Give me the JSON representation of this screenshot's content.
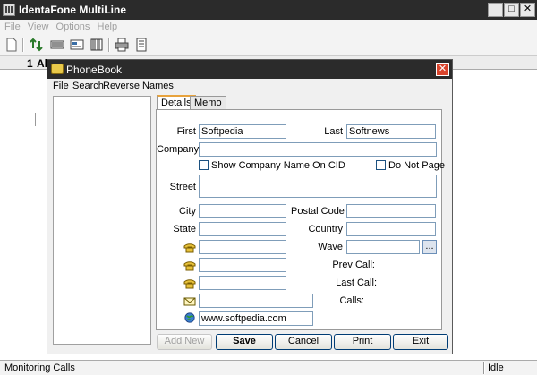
{
  "main": {
    "title": "IdentaFone MultiLine",
    "menu": [
      "File",
      "View",
      "Options",
      "Help"
    ],
    "grid": {
      "row_number": "1",
      "column_header": "Al"
    },
    "status": {
      "left": "Monitoring Calls",
      "right": "Idle"
    },
    "window_buttons": {
      "minimize": "_",
      "maximize": "□",
      "close": "✕"
    }
  },
  "dialog": {
    "title": "PhoneBook",
    "close": "✕",
    "menu": [
      "File",
      "Search",
      "Reverse Names"
    ],
    "tabs": [
      "Details",
      "Memo"
    ],
    "labels": {
      "first": "First",
      "last": "Last",
      "company": "Company",
      "street": "Street",
      "city": "City",
      "postal": "Postal Code",
      "state": "State",
      "country": "Country",
      "wave": "Wave",
      "prev_call": "Prev Call:",
      "last_call": "Last Call:",
      "calls": "Calls:"
    },
    "values": {
      "first": "Softpedia",
      "last": "Softnews",
      "company": "",
      "street": "",
      "city": "",
      "postal": "",
      "state": "",
      "country": "",
      "wave": "",
      "phone1": "",
      "phone2": "",
      "phone3": "",
      "email": "",
      "web": "www.softpedia.com"
    },
    "checkboxes": {
      "show_company": "Show Company Name On CID",
      "do_not_page": "Do Not Page"
    },
    "browse_button": "...",
    "buttons": {
      "add_new": "Add New",
      "save": "Save",
      "cancel": "Cancel",
      "print": "Print",
      "exit": "Exit"
    }
  },
  "colors": {
    "title_bar": "#2b2b2b",
    "close_red": "#d9442c",
    "field_border": "#7f9db9"
  }
}
